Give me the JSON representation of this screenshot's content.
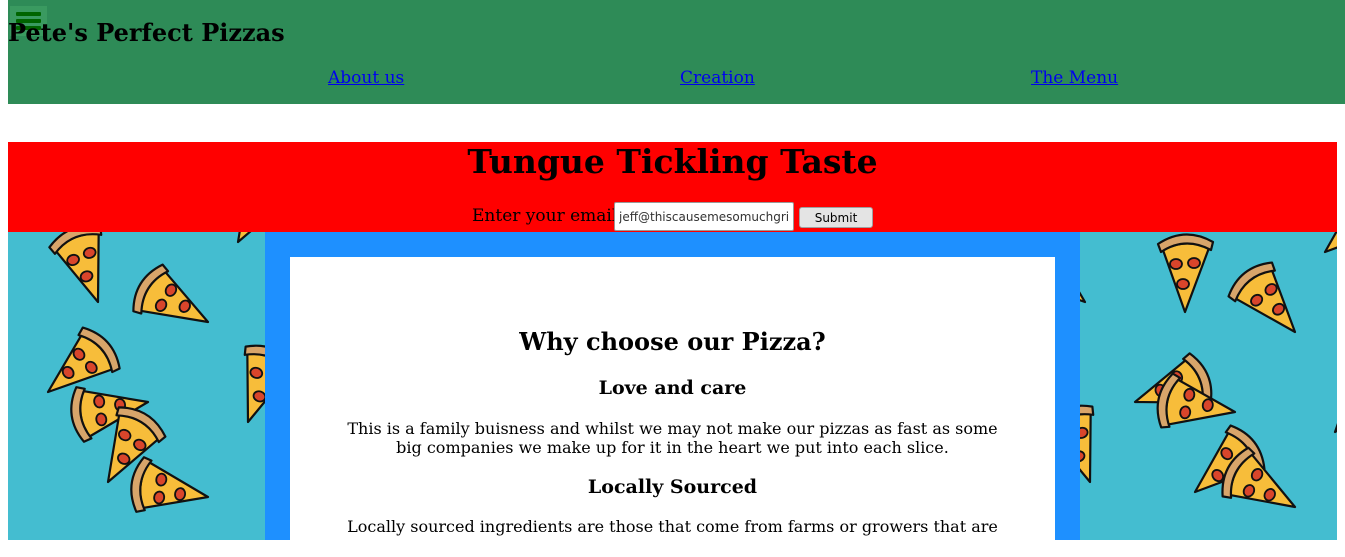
{
  "header": {
    "title": "Pete's Perfect Pizzas",
    "menu_icon": "hamburger-menu-icon",
    "nav": [
      {
        "label": "About us"
      },
      {
        "label": "Creation"
      },
      {
        "label": "The Menu"
      }
    ]
  },
  "banner": {
    "heading": "Tungue Tickling Taste",
    "email_label": "Enter your email",
    "email_value": "jeff@thiscausemesomuchgrief",
    "submit_label": "Submit"
  },
  "main": {
    "heading": "Why choose our Pizza?",
    "sections": [
      {
        "title": "Love and care",
        "text": "This is a family buisness and whilst we may not make our pizzas as fast as some big companies we make up for it in the heart we put into each slice."
      },
      {
        "title": "Locally Sourced",
        "text": "Locally sourced ingredients are those that come from farms or growers that are"
      }
    ]
  },
  "colors": {
    "header_bg": "#2e8b57",
    "banner_bg": "#ff0000",
    "frame_bg": "#1e90ff",
    "pattern_bg": "#44bdd0"
  }
}
